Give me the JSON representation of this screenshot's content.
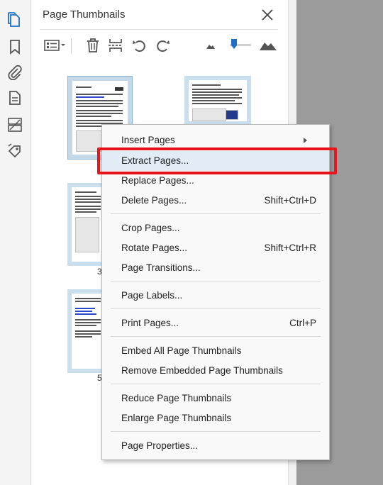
{
  "panel": {
    "title": "Page Thumbnails"
  },
  "rail": {
    "icons": [
      "pages-icon",
      "bookmark-icon",
      "attachment-icon",
      "document-icon",
      "layers-icon",
      "tag-icon"
    ]
  },
  "toolbar": {
    "icons": [
      "options-menu-icon",
      "delete-icon",
      "insert-pages-icon",
      "rotate-counterclockwise-icon",
      "rotate-clockwise-icon",
      "zoom-out-thumbnails-icon",
      "zoom-in-thumbnails-icon"
    ],
    "thumbnail_size": 0.2
  },
  "thumbnails": [
    {
      "number": "3"
    },
    {
      "number": "5"
    }
  ],
  "context_menu": {
    "items": [
      {
        "label": "Insert Pages",
        "shortcut": ""
      },
      {
        "label": "Extract Pages...",
        "shortcut": ""
      },
      {
        "label": "Replace Pages...",
        "shortcut": ""
      },
      {
        "label": "Delete Pages...",
        "shortcut": "Shift+Ctrl+D"
      },
      {
        "label": "Crop Pages...",
        "shortcut": ""
      },
      {
        "label": "Rotate Pages...",
        "shortcut": "Shift+Ctrl+R"
      },
      {
        "label": "Page Transitions...",
        "shortcut": ""
      },
      {
        "label": "Page Labels...",
        "shortcut": ""
      },
      {
        "label": "Print Pages...",
        "shortcut": "Ctrl+P"
      },
      {
        "label": "Embed All Page Thumbnails",
        "shortcut": ""
      },
      {
        "label": "Remove Embedded Page Thumbnails",
        "shortcut": ""
      },
      {
        "label": "Reduce Page Thumbnails",
        "shortcut": ""
      },
      {
        "label": "Enlarge Page Thumbnails",
        "shortcut": ""
      },
      {
        "label": "Page Properties...",
        "shortcut": ""
      }
    ],
    "highlighted": "Extract Pages..."
  },
  "colors": {
    "accent": "#1f6fc5",
    "highlight_box": "#e8161b",
    "menu_hover": "#e1ecf6",
    "doc_background": "#9b9b9b"
  }
}
